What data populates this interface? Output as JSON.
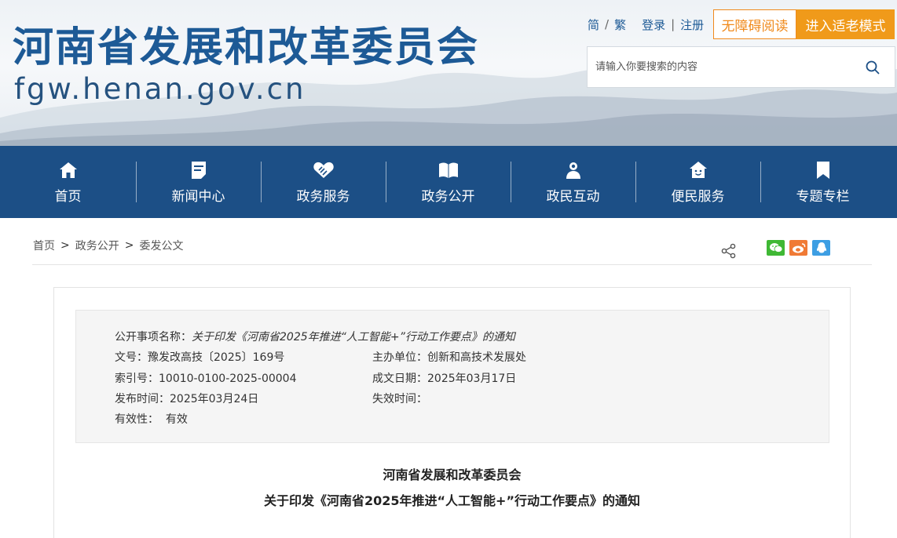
{
  "header": {
    "site_title": "河南省发展和改革委员会",
    "site_domain": "fgw.henan.gov.cn",
    "lang_simplified": "简",
    "lang_traditional": "繁",
    "lang_sep": "/",
    "login": "登录",
    "auth_sep": "|",
    "register": "注册",
    "accessibility_label": "无障碍阅读",
    "elder_mode_label": "进入适老模式",
    "search": {
      "placeholder": "请输入你要搜索的内容",
      "icon": "search-icon"
    }
  },
  "nav": {
    "items": [
      {
        "label": "首页",
        "icon": "home-icon"
      },
      {
        "label": "新闻中心",
        "icon": "news-icon"
      },
      {
        "label": "政务服务",
        "icon": "handshake-icon"
      },
      {
        "label": "政务公开",
        "icon": "book-icon"
      },
      {
        "label": "政民互动",
        "icon": "users-icon"
      },
      {
        "label": "便民服务",
        "icon": "house-smile-icon"
      },
      {
        "label": "专题专栏",
        "icon": "bookmark-icon"
      }
    ]
  },
  "breadcrumb": {
    "items": [
      "首页",
      "政务公开",
      "委发公文"
    ],
    "separator": ">"
  },
  "share": {
    "icons": [
      "share-icon",
      "wechat-icon",
      "weibo-icon",
      "qq-icon"
    ],
    "colors": {
      "wechat": "#3fb834",
      "weibo": "#f07a35",
      "qq": "#3d9ee3"
    }
  },
  "document": {
    "meta": {
      "item_name_label": "公开事项名称：",
      "item_name_value": "关于印发《河南省2025年推进“人工智能+”行动工作要点》的通知",
      "doc_no_label": "文号：",
      "doc_no_value": "豫发改高技〔2025〕169号",
      "host_label": "主办单位：",
      "host_value": "创新和高技术发展处",
      "index_label": "索引号：",
      "index_value": "10010-0100-2025-00004",
      "created_label": "成文日期：",
      "created_value": "2025年03月17日",
      "published_label": "发布时间：",
      "published_value": "2025年03月24日",
      "expiry_label": "失效时间：",
      "expiry_value": "",
      "validity_label": "有效性：",
      "validity_value": "有效"
    },
    "org": "河南省发展和改革委员会",
    "title": "关于印发《河南省2025年推进“人工智能+”行动工作要点》的通知"
  },
  "colors": {
    "brand_blue": "#1c4f86",
    "accent_orange": "#f09a1a"
  }
}
